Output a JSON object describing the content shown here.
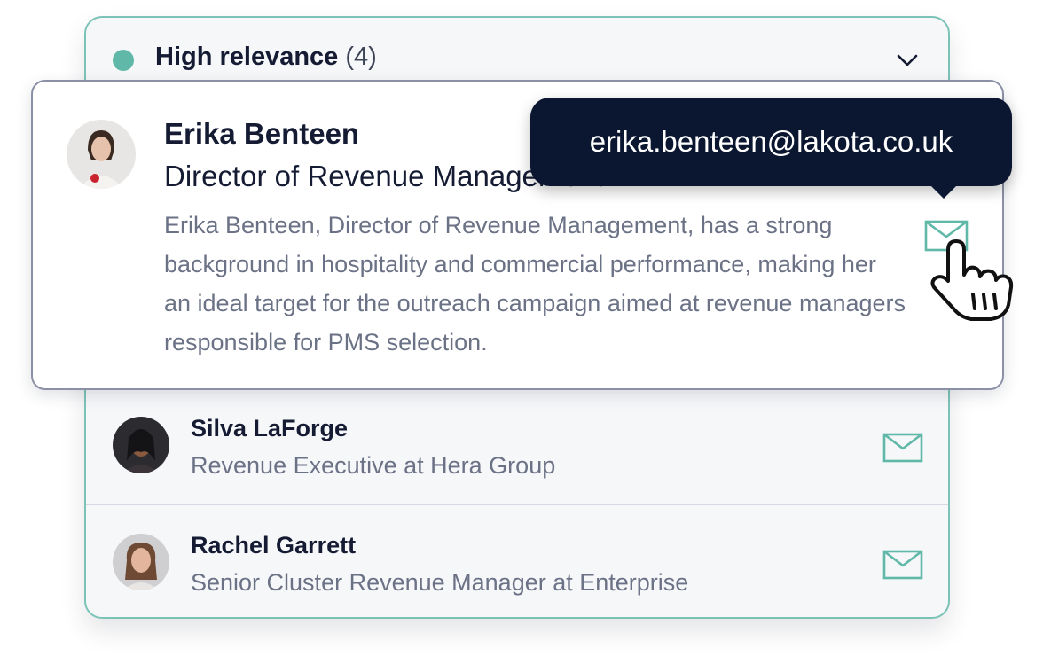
{
  "group": {
    "title": "High relevance",
    "count": "(4)",
    "dot_color": "#5fb8a8",
    "toggle_icon": "chevron-down-icon"
  },
  "expanded_contact": {
    "name": "Erika Benteen",
    "title": "Director of Revenue Management",
    "description": "Erika Benteen, Director of Revenue Management, has a strong background in hospitality and commercial performance, making her an ideal target for the outreach campaign aimed at revenue managers responsible for PMS selection.",
    "email_icon": "envelope-icon"
  },
  "tooltip": {
    "email": "erika.benteen@lakota.co.uk"
  },
  "contacts": [
    {
      "name": "Silva LaForge",
      "role": "Revenue Executive at Hera Group",
      "email_icon": "envelope-icon"
    },
    {
      "name": "Rachel Garrett",
      "role": "Senior Cluster Revenue Manager at Enterprise",
      "email_icon": "envelope-icon"
    }
  ],
  "colors": {
    "accent": "#5fb8a8",
    "border": "#7cc3b7",
    "tooltip_bg": "#0b1730",
    "text_primary": "#141b33",
    "text_secondary": "#6b7286"
  }
}
